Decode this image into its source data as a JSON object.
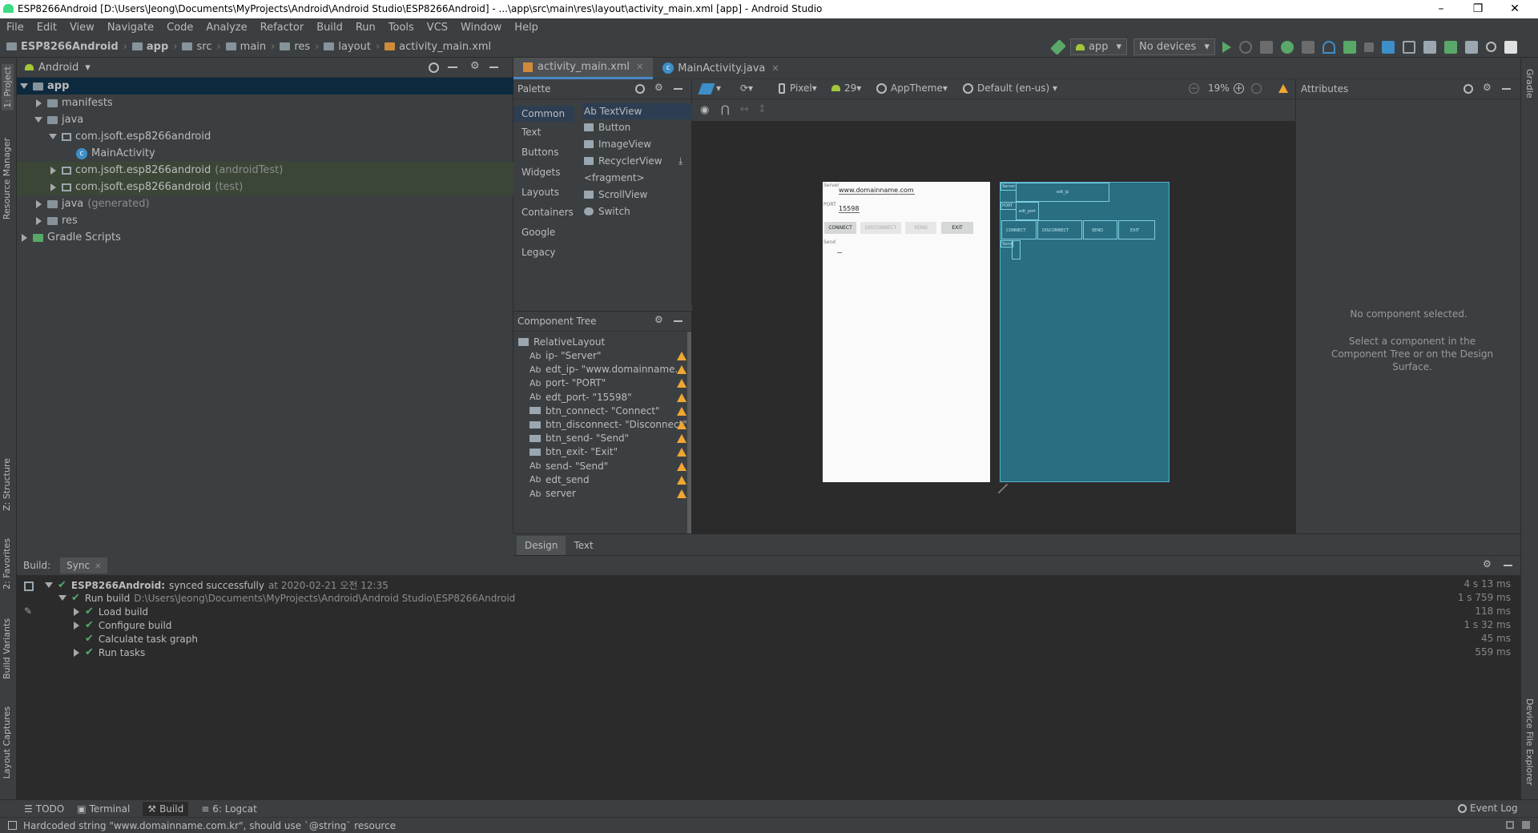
{
  "window": {
    "title": "ESP8266Android [D:\\Users\\Jeong\\Documents\\MyProjects\\Android\\Android Studio\\ESP8266Android] - ...\\app\\src\\main\\res\\layout\\activity_main.xml [app] - Android Studio",
    "min": "–",
    "max": "❐",
    "close": "✕"
  },
  "menu": [
    "File",
    "Edit",
    "View",
    "Navigate",
    "Code",
    "Analyze",
    "Refactor",
    "Build",
    "Run",
    "Tools",
    "VCS",
    "Window",
    "Help"
  ],
  "breadcrumb": [
    "ESP8266Android",
    "app",
    "src",
    "main",
    "res",
    "layout",
    "activity_main.xml"
  ],
  "toolbar": {
    "config": "app",
    "devices": "No devices"
  },
  "project": {
    "view": "Android",
    "tree": [
      {
        "label": "app",
        "depth": 0,
        "state": "down",
        "icon": "folder",
        "selected": true
      },
      {
        "label": "manifests",
        "depth": 1,
        "state": "right",
        "icon": "folder"
      },
      {
        "label": "java",
        "depth": 1,
        "state": "down",
        "icon": "folder"
      },
      {
        "label": "com.jsoft.esp8266android",
        "depth": 2,
        "state": "down",
        "icon": "package"
      },
      {
        "label": "MainActivity",
        "depth": 3,
        "state": "none",
        "icon": "class"
      },
      {
        "label": "com.jsoft.esp8266android",
        "suffix": "(androidTest)",
        "depth": 2,
        "state": "right",
        "icon": "package",
        "hl": true
      },
      {
        "label": "com.jsoft.esp8266android",
        "suffix": "(test)",
        "depth": 2,
        "state": "right",
        "icon": "package",
        "hl": true
      },
      {
        "label": "java",
        "suffix": "(generated)",
        "depth": 1,
        "state": "right",
        "icon": "folder"
      },
      {
        "label": "res",
        "depth": 1,
        "state": "right",
        "icon": "folder"
      },
      {
        "label": "Gradle Scripts",
        "depth": 0,
        "state": "right",
        "icon": "gradle"
      }
    ]
  },
  "tabs": [
    {
      "label": "activity_main.xml",
      "active": true
    },
    {
      "label": "MainActivity.java",
      "active": false
    }
  ],
  "palette": {
    "title": "Palette",
    "categories": [
      "Common",
      "Text",
      "Buttons",
      "Widgets",
      "Layouts",
      "Containers",
      "Google",
      "Legacy"
    ],
    "items": [
      "Ab TextView",
      "Button",
      "ImageView",
      "RecyclerView",
      "<fragment>",
      "ScrollView",
      "Switch"
    ]
  },
  "component_tree": {
    "title": "Component Tree",
    "root": "RelativeLayout",
    "items": [
      {
        "icon": "Ab",
        "label": "ip- \"Server\""
      },
      {
        "icon": "Ab",
        "label": "edt_ip- \"www.domainname..."
      },
      {
        "icon": "Ab",
        "label": "port- \"PORT\""
      },
      {
        "icon": "Ab",
        "label": "edt_port- \"15598\""
      },
      {
        "icon": "btn",
        "label": "btn_connect- \"Connect\""
      },
      {
        "icon": "btn",
        "label": "btn_disconnect- \"Disconnect\""
      },
      {
        "icon": "btn",
        "label": "btn_send- \"Send\""
      },
      {
        "icon": "btn",
        "label": "btn_exit- \"Exit\""
      },
      {
        "icon": "Ab",
        "label": "send- \"Send\""
      },
      {
        "icon": "Ab",
        "label": "edt_send"
      },
      {
        "icon": "Ab",
        "label": "server"
      }
    ]
  },
  "design_toolbar": {
    "device": "Pixel",
    "api": "29",
    "theme": "AppTheme",
    "locale": "Default (en-us)",
    "zoom": "19%"
  },
  "preview": {
    "server_label": "Server",
    "ip_value": "www.domainname.com",
    "port_label": "PORT",
    "port_value": "15598",
    "buttons": [
      "CONNECT",
      "DISCONNECT",
      "SEND",
      "EXIT"
    ],
    "send_label": "Send",
    "bp_labels": [
      "Server",
      "edt_ip",
      "PORT",
      "edt_port",
      "CONNECT",
      "DISCONNECT",
      "SEND",
      "EXIT",
      "Send"
    ]
  },
  "attributes": {
    "title": "Attributes",
    "empty": "No component selected.",
    "hint": "Select a component in the Component Tree or on the Design Surface."
  },
  "design_tabs": [
    "Design",
    "Text"
  ],
  "build": {
    "tabs": [
      "Build:",
      "Sync"
    ],
    "lines": [
      {
        "label": "ESP8266Android:",
        "extra": "synced successfully",
        "muted": "at 2020-02-21 오전 12:35",
        "time": "4 s 13 ms",
        "depth": 0,
        "state": "down"
      },
      {
        "label": "Run build",
        "muted": "D:\\Users\\Jeong\\Documents\\MyProjects\\Android\\Android Studio\\ESP8266Android",
        "time": "1 s 759 ms",
        "depth": 1,
        "state": "down"
      },
      {
        "label": "Load build",
        "time": "118 ms",
        "depth": 2,
        "state": "right"
      },
      {
        "label": "Configure build",
        "time": "1 s 32 ms",
        "depth": 2,
        "state": "right"
      },
      {
        "label": "Calculate task graph",
        "time": "45 ms",
        "depth": 2,
        "state": "none"
      },
      {
        "label": "Run tasks",
        "time": "559 ms",
        "depth": 2,
        "state": "right"
      }
    ]
  },
  "bottom_tabs": [
    "TODO",
    "Terminal",
    "Build",
    "6: Logcat"
  ],
  "event_log": "Event Log",
  "status": "Hardcoded string \"www.domainname.com.kr\", should use `@string` resource",
  "side_tabs": {
    "left": [
      "1: Project",
      "Resource Manager",
      "Z: Structure",
      "2: Favorites",
      "Build Variants",
      "Layout Captures"
    ],
    "right": [
      "Gradle",
      "Device File Explorer"
    ]
  },
  "colors": {
    "accent": "#4a88c7",
    "check": "#59a869",
    "warn": "#f0a732",
    "blueprint": "#2a6e82"
  }
}
